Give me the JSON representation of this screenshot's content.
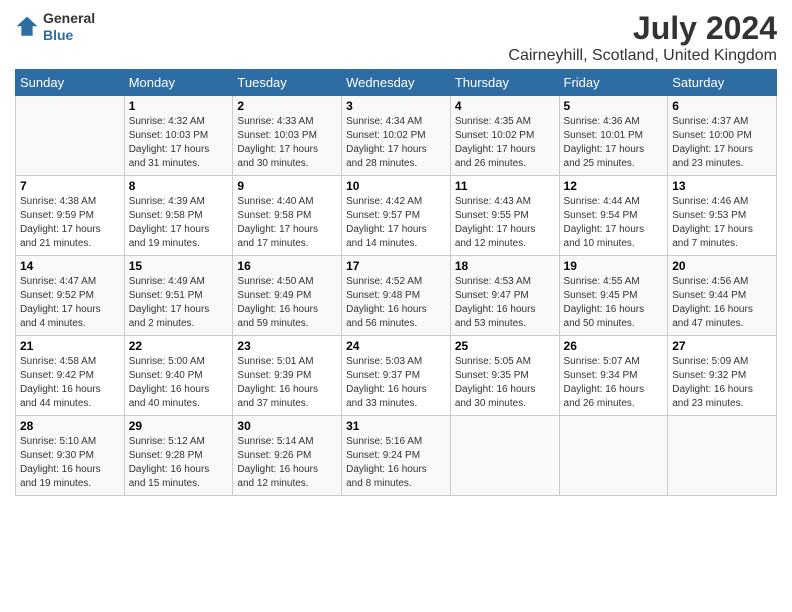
{
  "header": {
    "logo_line1": "General",
    "logo_line2": "Blue",
    "month_year": "July 2024",
    "location": "Cairneyhill, Scotland, United Kingdom"
  },
  "days_of_week": [
    "Sunday",
    "Monday",
    "Tuesday",
    "Wednesday",
    "Thursday",
    "Friday",
    "Saturday"
  ],
  "weeks": [
    [
      {
        "day": "",
        "info": ""
      },
      {
        "day": "1",
        "info": "Sunrise: 4:32 AM\nSunset: 10:03 PM\nDaylight: 17 hours and 31 minutes."
      },
      {
        "day": "2",
        "info": "Sunrise: 4:33 AM\nSunset: 10:03 PM\nDaylight: 17 hours and 30 minutes."
      },
      {
        "day": "3",
        "info": "Sunrise: 4:34 AM\nSunset: 10:02 PM\nDaylight: 17 hours and 28 minutes."
      },
      {
        "day": "4",
        "info": "Sunrise: 4:35 AM\nSunset: 10:02 PM\nDaylight: 17 hours and 26 minutes."
      },
      {
        "day": "5",
        "info": "Sunrise: 4:36 AM\nSunset: 10:01 PM\nDaylight: 17 hours and 25 minutes."
      },
      {
        "day": "6",
        "info": "Sunrise: 4:37 AM\nSunset: 10:00 PM\nDaylight: 17 hours and 23 minutes."
      }
    ],
    [
      {
        "day": "7",
        "info": "Sunrise: 4:38 AM\nSunset: 9:59 PM\nDaylight: 17 hours and 21 minutes."
      },
      {
        "day": "8",
        "info": "Sunrise: 4:39 AM\nSunset: 9:58 PM\nDaylight: 17 hours and 19 minutes."
      },
      {
        "day": "9",
        "info": "Sunrise: 4:40 AM\nSunset: 9:58 PM\nDaylight: 17 hours and 17 minutes."
      },
      {
        "day": "10",
        "info": "Sunrise: 4:42 AM\nSunset: 9:57 PM\nDaylight: 17 hours and 14 minutes."
      },
      {
        "day": "11",
        "info": "Sunrise: 4:43 AM\nSunset: 9:55 PM\nDaylight: 17 hours and 12 minutes."
      },
      {
        "day": "12",
        "info": "Sunrise: 4:44 AM\nSunset: 9:54 PM\nDaylight: 17 hours and 10 minutes."
      },
      {
        "day": "13",
        "info": "Sunrise: 4:46 AM\nSunset: 9:53 PM\nDaylight: 17 hours and 7 minutes."
      }
    ],
    [
      {
        "day": "14",
        "info": "Sunrise: 4:47 AM\nSunset: 9:52 PM\nDaylight: 17 hours and 4 minutes."
      },
      {
        "day": "15",
        "info": "Sunrise: 4:49 AM\nSunset: 9:51 PM\nDaylight: 17 hours and 2 minutes."
      },
      {
        "day": "16",
        "info": "Sunrise: 4:50 AM\nSunset: 9:49 PM\nDaylight: 16 hours and 59 minutes."
      },
      {
        "day": "17",
        "info": "Sunrise: 4:52 AM\nSunset: 9:48 PM\nDaylight: 16 hours and 56 minutes."
      },
      {
        "day": "18",
        "info": "Sunrise: 4:53 AM\nSunset: 9:47 PM\nDaylight: 16 hours and 53 minutes."
      },
      {
        "day": "19",
        "info": "Sunrise: 4:55 AM\nSunset: 9:45 PM\nDaylight: 16 hours and 50 minutes."
      },
      {
        "day": "20",
        "info": "Sunrise: 4:56 AM\nSunset: 9:44 PM\nDaylight: 16 hours and 47 minutes."
      }
    ],
    [
      {
        "day": "21",
        "info": "Sunrise: 4:58 AM\nSunset: 9:42 PM\nDaylight: 16 hours and 44 minutes."
      },
      {
        "day": "22",
        "info": "Sunrise: 5:00 AM\nSunset: 9:40 PM\nDaylight: 16 hours and 40 minutes."
      },
      {
        "day": "23",
        "info": "Sunrise: 5:01 AM\nSunset: 9:39 PM\nDaylight: 16 hours and 37 minutes."
      },
      {
        "day": "24",
        "info": "Sunrise: 5:03 AM\nSunset: 9:37 PM\nDaylight: 16 hours and 33 minutes."
      },
      {
        "day": "25",
        "info": "Sunrise: 5:05 AM\nSunset: 9:35 PM\nDaylight: 16 hours and 30 minutes."
      },
      {
        "day": "26",
        "info": "Sunrise: 5:07 AM\nSunset: 9:34 PM\nDaylight: 16 hours and 26 minutes."
      },
      {
        "day": "27",
        "info": "Sunrise: 5:09 AM\nSunset: 9:32 PM\nDaylight: 16 hours and 23 minutes."
      }
    ],
    [
      {
        "day": "28",
        "info": "Sunrise: 5:10 AM\nSunset: 9:30 PM\nDaylight: 16 hours and 19 minutes."
      },
      {
        "day": "29",
        "info": "Sunrise: 5:12 AM\nSunset: 9:28 PM\nDaylight: 16 hours and 15 minutes."
      },
      {
        "day": "30",
        "info": "Sunrise: 5:14 AM\nSunset: 9:26 PM\nDaylight: 16 hours and 12 minutes."
      },
      {
        "day": "31",
        "info": "Sunrise: 5:16 AM\nSunset: 9:24 PM\nDaylight: 16 hours and 8 minutes."
      },
      {
        "day": "",
        "info": ""
      },
      {
        "day": "",
        "info": ""
      },
      {
        "day": "",
        "info": ""
      }
    ]
  ]
}
